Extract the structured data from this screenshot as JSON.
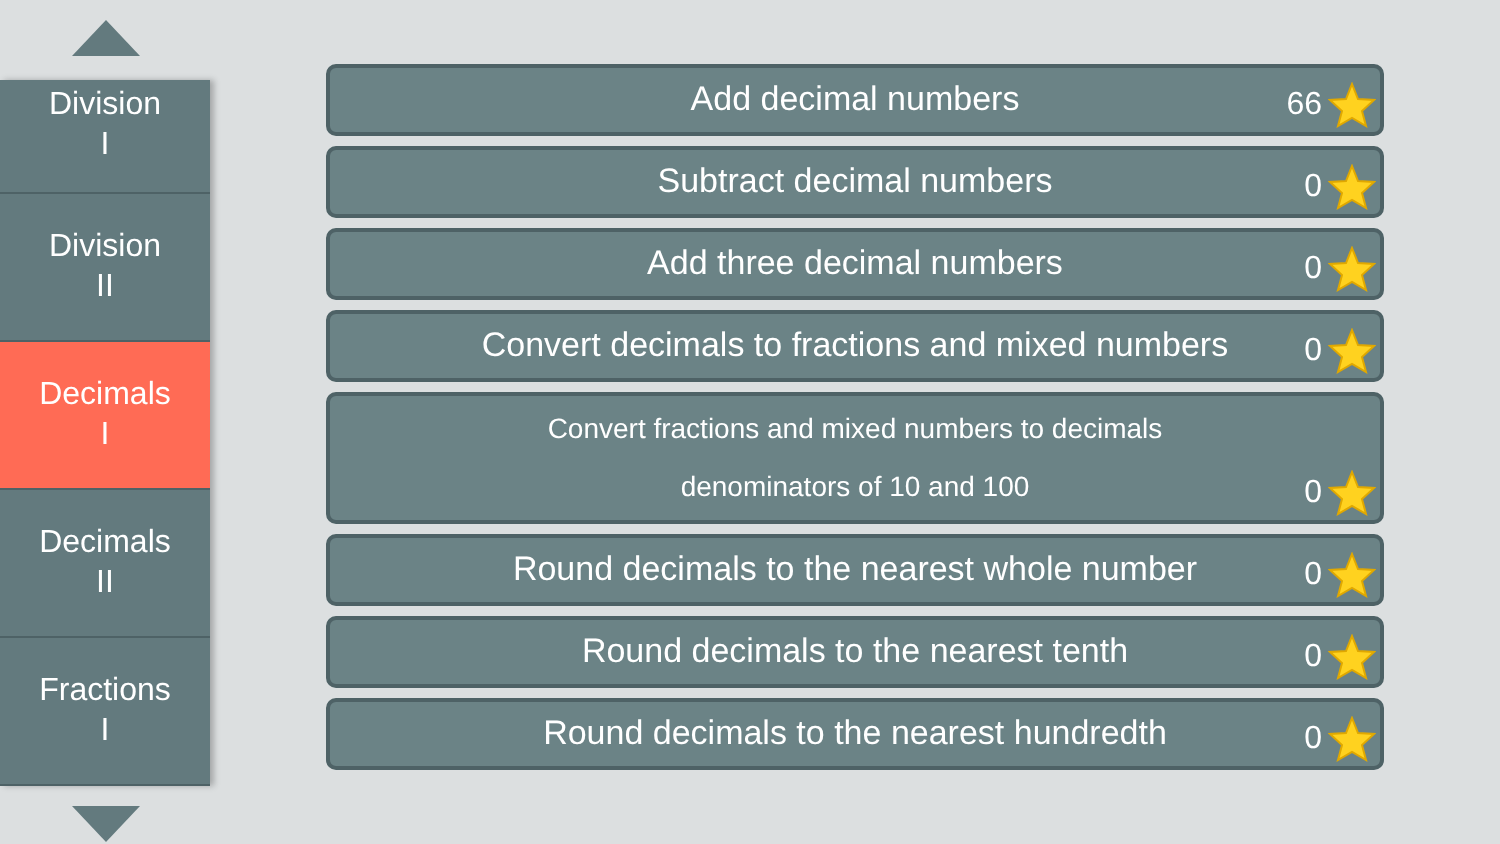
{
  "sidebar": {
    "items": [
      {
        "name": "Division",
        "numeral": "I",
        "selected": false
      },
      {
        "name": "Division",
        "numeral": "II",
        "selected": false
      },
      {
        "name": "Decimals",
        "numeral": "I",
        "selected": true
      },
      {
        "name": "Decimals",
        "numeral": "II",
        "selected": false
      },
      {
        "name": "Fractions",
        "numeral": "I",
        "selected": false
      }
    ]
  },
  "lessons": [
    {
      "lines": [
        "Add decimal numbers"
      ],
      "score": "66"
    },
    {
      "lines": [
        "Subtract decimal numbers"
      ],
      "score": "0"
    },
    {
      "lines": [
        "Add three decimal numbers"
      ],
      "score": "0"
    },
    {
      "lines": [
        "Convert decimals to fractions and mixed numbers"
      ],
      "score": "0"
    },
    {
      "lines": [
        "Convert fractions and mixed numbers to decimals",
        "denominators of 10 and 100"
      ],
      "score": "0"
    },
    {
      "lines": [
        "Round decimals to the nearest whole number"
      ],
      "score": "0"
    },
    {
      "lines": [
        "Round decimals to the nearest tenth"
      ],
      "score": "0"
    },
    {
      "lines": [
        "Round decimals to the nearest hundredth"
      ],
      "score": "0"
    }
  ]
}
